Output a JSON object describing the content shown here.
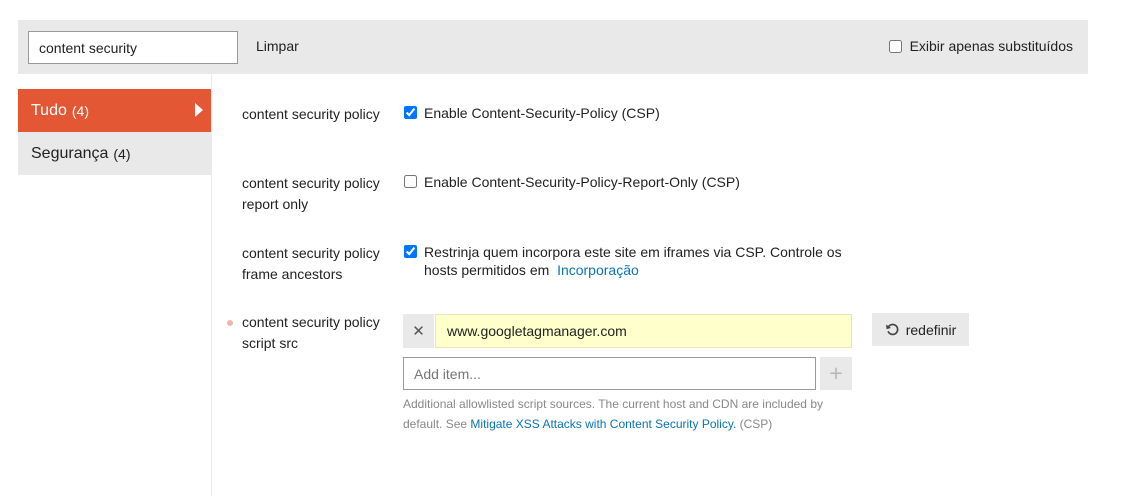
{
  "filter": {
    "search_value": "content security",
    "clear_label": "Limpar",
    "only_overridden_label": "Exibir apenas substituídos",
    "only_overridden_checked": false
  },
  "sidebar": {
    "items": [
      {
        "label": "Tudo",
        "count": "(4)",
        "active": true
      },
      {
        "label": "Segurança",
        "count": "(4)",
        "active": false
      }
    ]
  },
  "settings": {
    "csp": {
      "label": "content security policy",
      "description": "Enable Content-Security-Policy (CSP)",
      "checked": true
    },
    "csp_report_only": {
      "label": "content security policy report only",
      "description": "Enable Content-Security-Policy-Report-Only (CSP)",
      "checked": false
    },
    "csp_frame_ancestors": {
      "label": "content security policy frame ancestors",
      "description": "Restrinja quem incorpora este site em iframes via CSP. Controle os hosts permitidos em",
      "link_label": "Incorporação",
      "checked": true
    },
    "csp_script_src": {
      "label": "content security policy script src",
      "items": [
        "www.googletagmanager.com"
      ],
      "add_placeholder": "Add item...",
      "reset_label": "redefinir",
      "help_text": "Additional allowlisted script sources. The current host and CDN are included by default. See",
      "help_link_label": "Mitigate XSS Attacks with Content Security Policy.",
      "help_suffix": "(CSP)"
    }
  },
  "colors": {
    "accent": "#e45735",
    "panel_bg": "#e9e9e9",
    "link": "#0a74b6",
    "overridden_bg": "#ffffcc",
    "overridden_dot": "#f4b4ad"
  }
}
